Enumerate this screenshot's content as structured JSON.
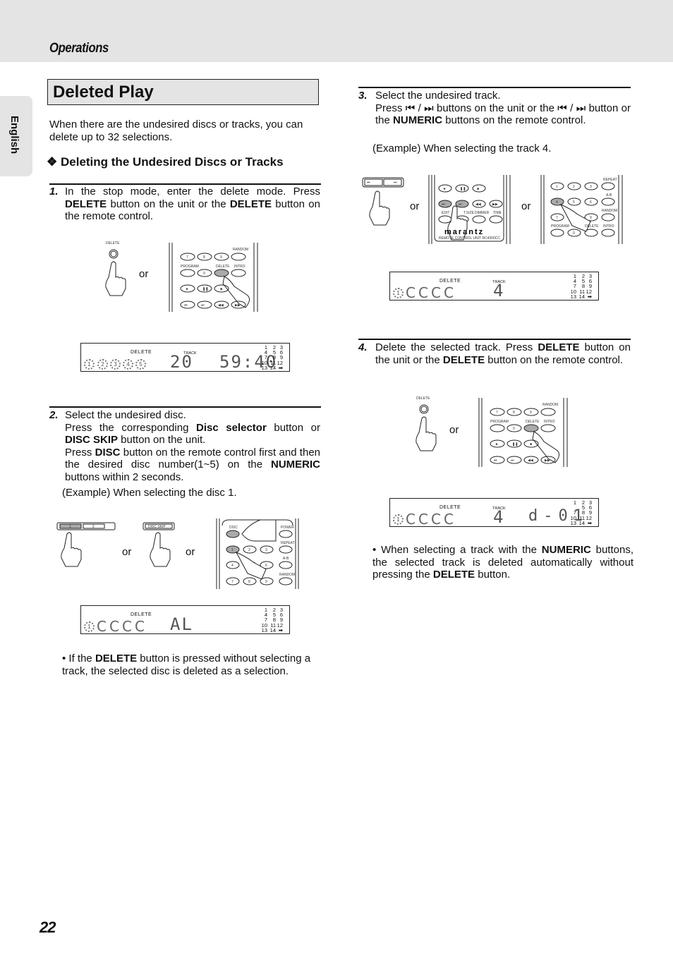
{
  "header": {
    "section": "Operations",
    "language_tab": "English"
  },
  "page": {
    "title": "Deleted Play",
    "intro": "When there are the undesired discs or tracks, you can delete up to 32 selections.",
    "subheading": "Deleting the Undesired Discs or Tracks",
    "subheading_icon": "❖",
    "page_number": "22"
  },
  "steps": [
    {
      "num": "1.",
      "parts": [
        {
          "t": "In the stop mode, enter the delete mode. Press "
        },
        {
          "b": "DELETE"
        },
        {
          "t": " button on the unit or the "
        },
        {
          "b": "DELETE"
        },
        {
          "t": " button on the remote control."
        }
      ],
      "or_labels": [
        "or"
      ],
      "figure": {
        "unit_label": "DELETE",
        "remote_labels": [
          "RANDOM",
          "PROGRAM",
          "DELETE",
          "INTRO",
          "7",
          "8",
          "9",
          "0"
        ]
      },
      "display": {
        "delete_label": "DELETE",
        "track_label": "TRACK",
        "discs": [
          "1",
          "2",
          "3",
          "4",
          "5"
        ],
        "main": "20",
        "time": "59:40"
      }
    },
    {
      "num": "2.",
      "line1": "Select the undesired disc.",
      "parts2": [
        {
          "t": "Press the corresponding "
        },
        {
          "b": "Disc selector"
        },
        {
          "t": " button or "
        },
        {
          "b": "DISC SKIP"
        },
        {
          "t": " button on the unit."
        }
      ],
      "parts3": [
        {
          "t": "Press "
        },
        {
          "b": "DISC"
        },
        {
          "t": " button on the remote control first and then the desired disc number(1~5) on the "
        },
        {
          "b": "NUMERIC"
        },
        {
          "t": " buttons within 2 seconds."
        }
      ],
      "example": "(Example) When selecting the disc 1.",
      "or_labels": [
        "or",
        "or"
      ],
      "figure": {
        "selector_labels": [
          "1",
          "2"
        ],
        "disc_skip_label": "DISC SKIP",
        "remote_labels": [
          "DISC",
          "POWER",
          "REPEAT",
          "A-B",
          "RANDOM",
          "1",
          "2",
          "3",
          "4",
          "5",
          "6",
          "7",
          "8",
          "9"
        ]
      },
      "display": {
        "delete_label": "DELETE",
        "discs": [
          "1"
        ],
        "main": "AL"
      },
      "note_parts": [
        {
          "t": "• If the "
        },
        {
          "b": "DELETE"
        },
        {
          "t": " button is pressed without selecting a track, the selected disc is deleted as a selection."
        }
      ]
    },
    {
      "num": "3.",
      "line1": "Select the undesired track.",
      "parts2": [
        {
          "t": "Press ⏮ / ⏭ buttons on the unit or the ⏮ / ⏭ button or the "
        },
        {
          "b": "NUMERIC"
        },
        {
          "t": " buttons on the remote control."
        }
      ],
      "example": "(Example) When selecting the track 4.",
      "or_labels": [
        "or",
        "or"
      ],
      "figure": {
        "remote1_labels": [
          "EDIT",
          "T.SIZE",
          "DIMMER",
          "TIME"
        ],
        "brand": "marantz",
        "remote1_caption": "REMOTE CONTROL UNIT RC4300CC",
        "remote2_labels": [
          "REPEAT",
          "A-B",
          "RANDOM",
          "PROGRAM",
          "DELETE",
          "INTRO",
          "1",
          "2",
          "3",
          "4",
          "5",
          "6",
          "7",
          "8",
          "9",
          "0"
        ]
      },
      "display": {
        "delete_label": "DELETE",
        "track_label": "TRACK",
        "discs": [
          "1"
        ],
        "main": "4"
      }
    },
    {
      "num": "4.",
      "parts": [
        {
          "t": "Delete the selected track. Press "
        },
        {
          "b": "DELETE"
        },
        {
          "t": " button on the unit or the "
        },
        {
          "b": "DELETE"
        },
        {
          "t": " button on the remote control."
        }
      ],
      "or_labels": [
        "or"
      ],
      "figure": {
        "unit_label": "DELETE",
        "remote_labels": [
          "RANDOM",
          "PROGRAM",
          "DELETE",
          "INTRO",
          "7",
          "8",
          "9",
          "0"
        ]
      },
      "display": {
        "delete_label": "DELETE",
        "track_label": "TRACK",
        "discs": [
          "1"
        ],
        "main": "4",
        "time": "d-01"
      },
      "note_parts": [
        {
          "t": "• When selecting a track with the "
        },
        {
          "b": "NUMERIC"
        },
        {
          "t": " buttons, the selected track is deleted automatically without pressing the "
        },
        {
          "b": "DELETE"
        },
        {
          "t": " button."
        }
      ]
    }
  ],
  "track_grid": [
    "1",
    "2",
    "3",
    "4",
    "5",
    "6",
    "7",
    "8",
    "9",
    "10",
    "11",
    "12",
    "13",
    "14",
    "➡"
  ]
}
